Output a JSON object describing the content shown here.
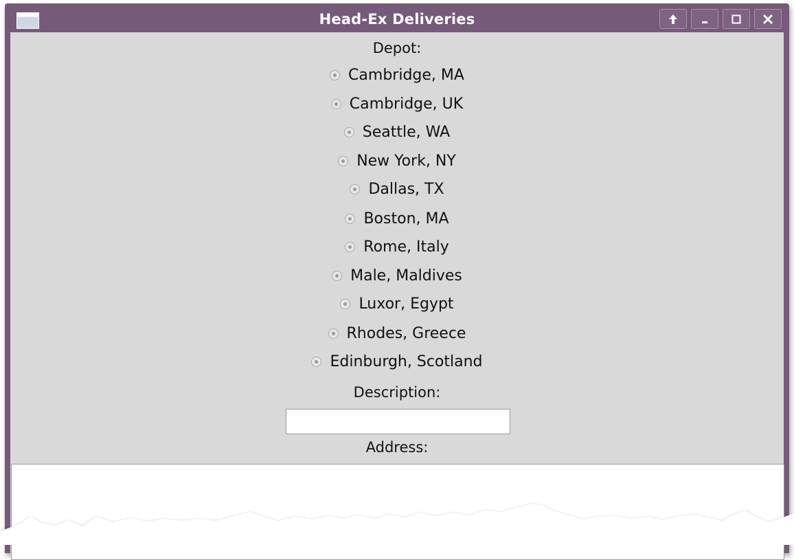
{
  "window": {
    "title": "Head-Ex Deliveries",
    "controls": [
      "up",
      "minimize",
      "maximize",
      "close"
    ]
  },
  "form": {
    "depot_label": "Depot:",
    "depots": [
      "Cambridge, MA",
      "Cambridge, UK",
      "Seattle, WA",
      "New York, NY",
      "Dallas, TX",
      "Boston, MA",
      "Rome, Italy",
      "Male, Maldives",
      "Luxor, Egypt",
      "Rhodes, Greece",
      "Edinburgh, Scotland"
    ],
    "description_label": "Description:",
    "description_value": "",
    "address_label": "Address:",
    "address_value": ""
  },
  "colors": {
    "titlebar": "#765a7a",
    "window_bg": "#d9d9d9",
    "input_bg": "#ffffff"
  }
}
